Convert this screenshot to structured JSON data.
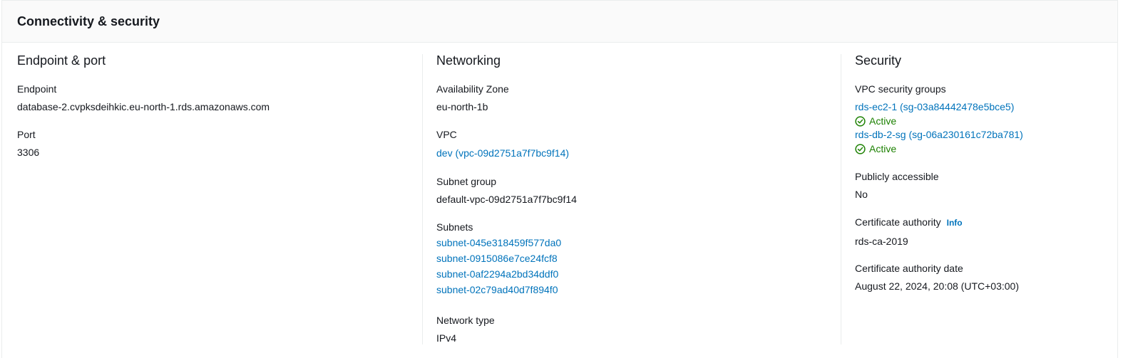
{
  "panel": {
    "title": "Connectivity & security"
  },
  "endpoint_port": {
    "heading": "Endpoint & port",
    "endpoint_label": "Endpoint",
    "endpoint_value": "database-2.cvpksdeihkic.eu-north-1.rds.amazonaws.com",
    "port_label": "Port",
    "port_value": "3306"
  },
  "networking": {
    "heading": "Networking",
    "az_label": "Availability Zone",
    "az_value": "eu-north-1b",
    "vpc_label": "VPC",
    "vpc_value": "dev (vpc-09d2751a7f7bc9f14)",
    "subnet_group_label": "Subnet group",
    "subnet_group_value": "default-vpc-09d2751a7f7bc9f14",
    "subnets_label": "Subnets",
    "subnets": [
      "subnet-045e318459f577da0",
      "subnet-0915086e7ce24fcf8",
      "subnet-0af2294a2bd34ddf0",
      "subnet-02c79ad40d7f894f0"
    ],
    "network_type_label": "Network type",
    "network_type_value": "IPv4"
  },
  "security": {
    "heading": "Security",
    "vpc_sg_label": "VPC security groups",
    "security_groups": [
      {
        "name": "rds-ec2-1 (sg-03a84442478e5bce5)",
        "status": "Active"
      },
      {
        "name": "rds-db-2-sg (sg-06a230161c72ba781)",
        "status": "Active"
      }
    ],
    "public_label": "Publicly accessible",
    "public_value": "No",
    "ca_label": "Certificate authority",
    "ca_info": "Info",
    "ca_value": "rds-ca-2019",
    "ca_date_label": "Certificate authority date",
    "ca_date_value": "August 22, 2024, 20:08 (UTC+03:00)"
  },
  "colors": {
    "link": "#0073bb",
    "status_active": "#1d8102",
    "header_bg": "#fafafa",
    "border": "#eaeded"
  }
}
